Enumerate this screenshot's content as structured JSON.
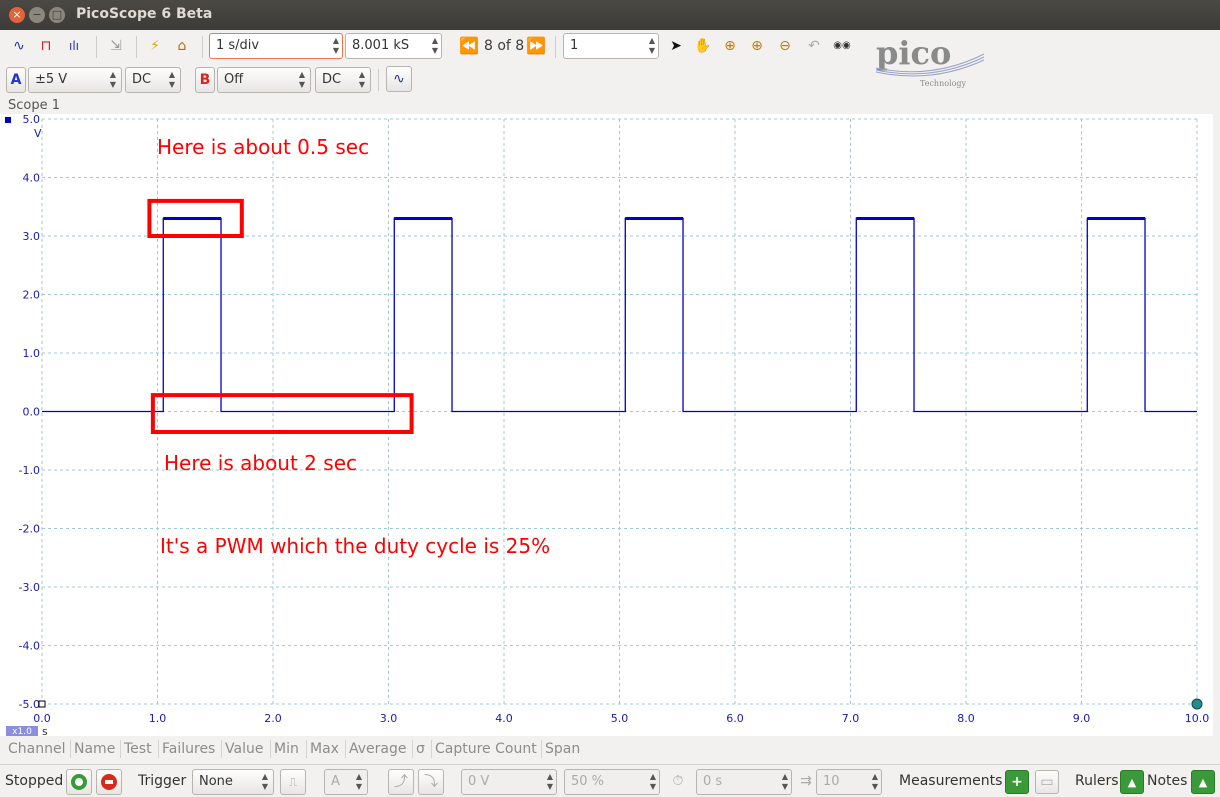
{
  "window": {
    "title": "PicoScope 6 Beta"
  },
  "toolbar": {
    "timebase": "1 s/div",
    "samples": "8.001 kS",
    "capture_nav": "8 of 8",
    "capture_count": "1"
  },
  "channels": {
    "a": {
      "letter": "A",
      "range": "±5 V",
      "coupling": "DC"
    },
    "b": {
      "letter": "B",
      "range": "Off",
      "coupling": "DC"
    }
  },
  "logo": {
    "text": "pico",
    "sub": "Technology"
  },
  "scope": {
    "label": "Scope 1",
    "y_unit": "V",
    "x_unit": "s",
    "zoom_badge": "x1.0",
    "y_ticks": [
      "5.0",
      "4.0",
      "3.0",
      "2.0",
      "1.0",
      "0.0",
      "-1.0",
      "-2.0",
      "-3.0",
      "-4.0",
      "-5.0"
    ],
    "x_ticks": [
      "0.0",
      "1.0",
      "2.0",
      "3.0",
      "4.0",
      "5.0",
      "6.0",
      "7.0",
      "8.0",
      "9.0",
      "10.0"
    ],
    "annotations": {
      "high": "Here is about 0.5 sec",
      "low": "Here is about 2 sec",
      "summary": "It's a PWM which the duty cycle is 25%"
    },
    "colors": {
      "trace": "#0000c8",
      "grid": "#9fc9d6",
      "axis_text": "#1a1ab4",
      "annotation": "#ff0000"
    }
  },
  "chart_data": {
    "type": "line",
    "xlabel": "s",
    "ylabel": "V",
    "xlim": [
      0,
      10
    ],
    "ylim": [
      -5,
      5
    ],
    "grid": true,
    "series": [
      {
        "x": [
          0,
          1.05,
          1.05,
          1.55,
          1.55,
          3.05,
          3.05,
          3.55,
          3.55,
          5.05,
          5.05,
          5.55,
          5.55,
          7.05,
          7.05,
          7.55,
          7.55,
          9.05,
          9.05,
          9.55,
          9.55,
          10
        ],
        "y": [
          0,
          0,
          3.3,
          3.3,
          0,
          0,
          3.3,
          3.3,
          0,
          0,
          3.3,
          3.3,
          0,
          0,
          3.3,
          3.3,
          0,
          0,
          3.3,
          3.3,
          0,
          0
        ]
      }
    ]
  },
  "measurements": {
    "columns": [
      "Channel",
      "Name",
      "Test",
      "Failures",
      "Value",
      "Min",
      "Max",
      "Average",
      "σ",
      "Capture Count",
      "Span"
    ]
  },
  "statusbar": {
    "state": "Stopped",
    "trigger_label": "Trigger",
    "trigger_mode": "None",
    "trigger_source": "A",
    "threshold": "0 V",
    "pre_trigger": "50 %",
    "delay": "0 s",
    "rapid_count": "10",
    "measurements_label": "Measurements",
    "rulers_label": "Rulers",
    "notes_label": "Notes"
  }
}
